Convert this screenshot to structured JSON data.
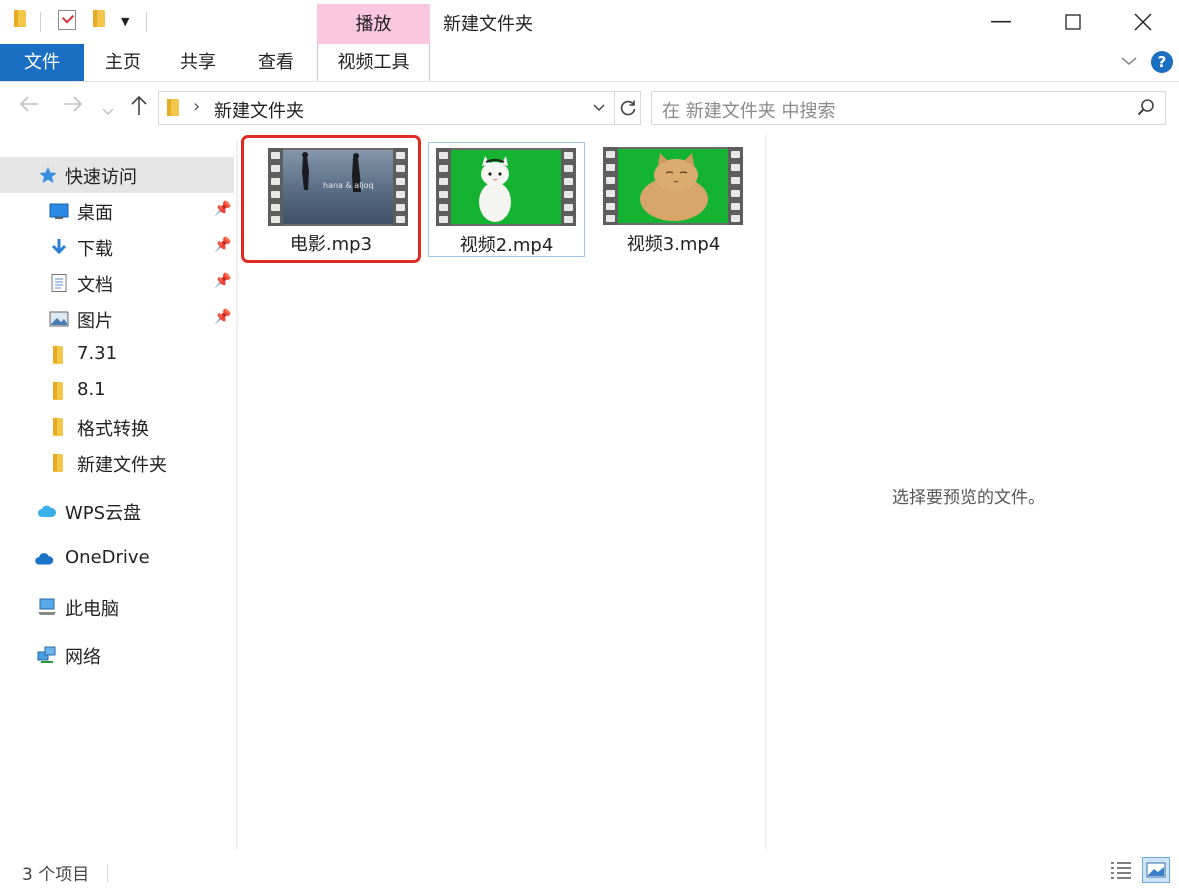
{
  "window": {
    "title": "新建文件夹",
    "context_tab_header": "播放",
    "minimize": "—",
    "maximize": "☐",
    "close": "✕"
  },
  "ribbon": {
    "tabs": [
      "文件",
      "主页",
      "共享",
      "查看",
      "视频工具"
    ],
    "help": "?"
  },
  "address": {
    "path": "新建文件夹",
    "search_placeholder": "在 新建文件夹 中搜索"
  },
  "sidebar": {
    "quick_access": "快速访问",
    "pinned": [
      {
        "label": "桌面",
        "icon": "desktop-icon"
      },
      {
        "label": "下载",
        "icon": "download-icon"
      },
      {
        "label": "文档",
        "icon": "documents-icon"
      },
      {
        "label": "图片",
        "icon": "pictures-icon"
      }
    ],
    "folders": [
      "7.31",
      "8.1",
      "格式转换",
      "新建文件夹"
    ],
    "locations": [
      {
        "label": "WPS云盘",
        "icon": "cloud-icon"
      },
      {
        "label": "OneDrive",
        "icon": "onedrive-icon"
      },
      {
        "label": "此电脑",
        "icon": "computer-icon"
      },
      {
        "label": "网络",
        "icon": "network-icon"
      }
    ]
  },
  "files": [
    {
      "name": "电影.mp3",
      "thumb_caption": "hana & aljoq",
      "highlighted": true
    },
    {
      "name": "视频2.mp4",
      "highlighted": false
    },
    {
      "name": "视频3.mp4",
      "highlighted": false
    }
  ],
  "preview": {
    "message": "选择要预览的文件。"
  },
  "status": {
    "item_count": "3 个项目"
  },
  "colors": {
    "accent_blue": "#1a6fc2",
    "context_tab_pink": "#fbc7e0",
    "highlight_red": "#e02a24",
    "green_screen": "#14b432"
  }
}
